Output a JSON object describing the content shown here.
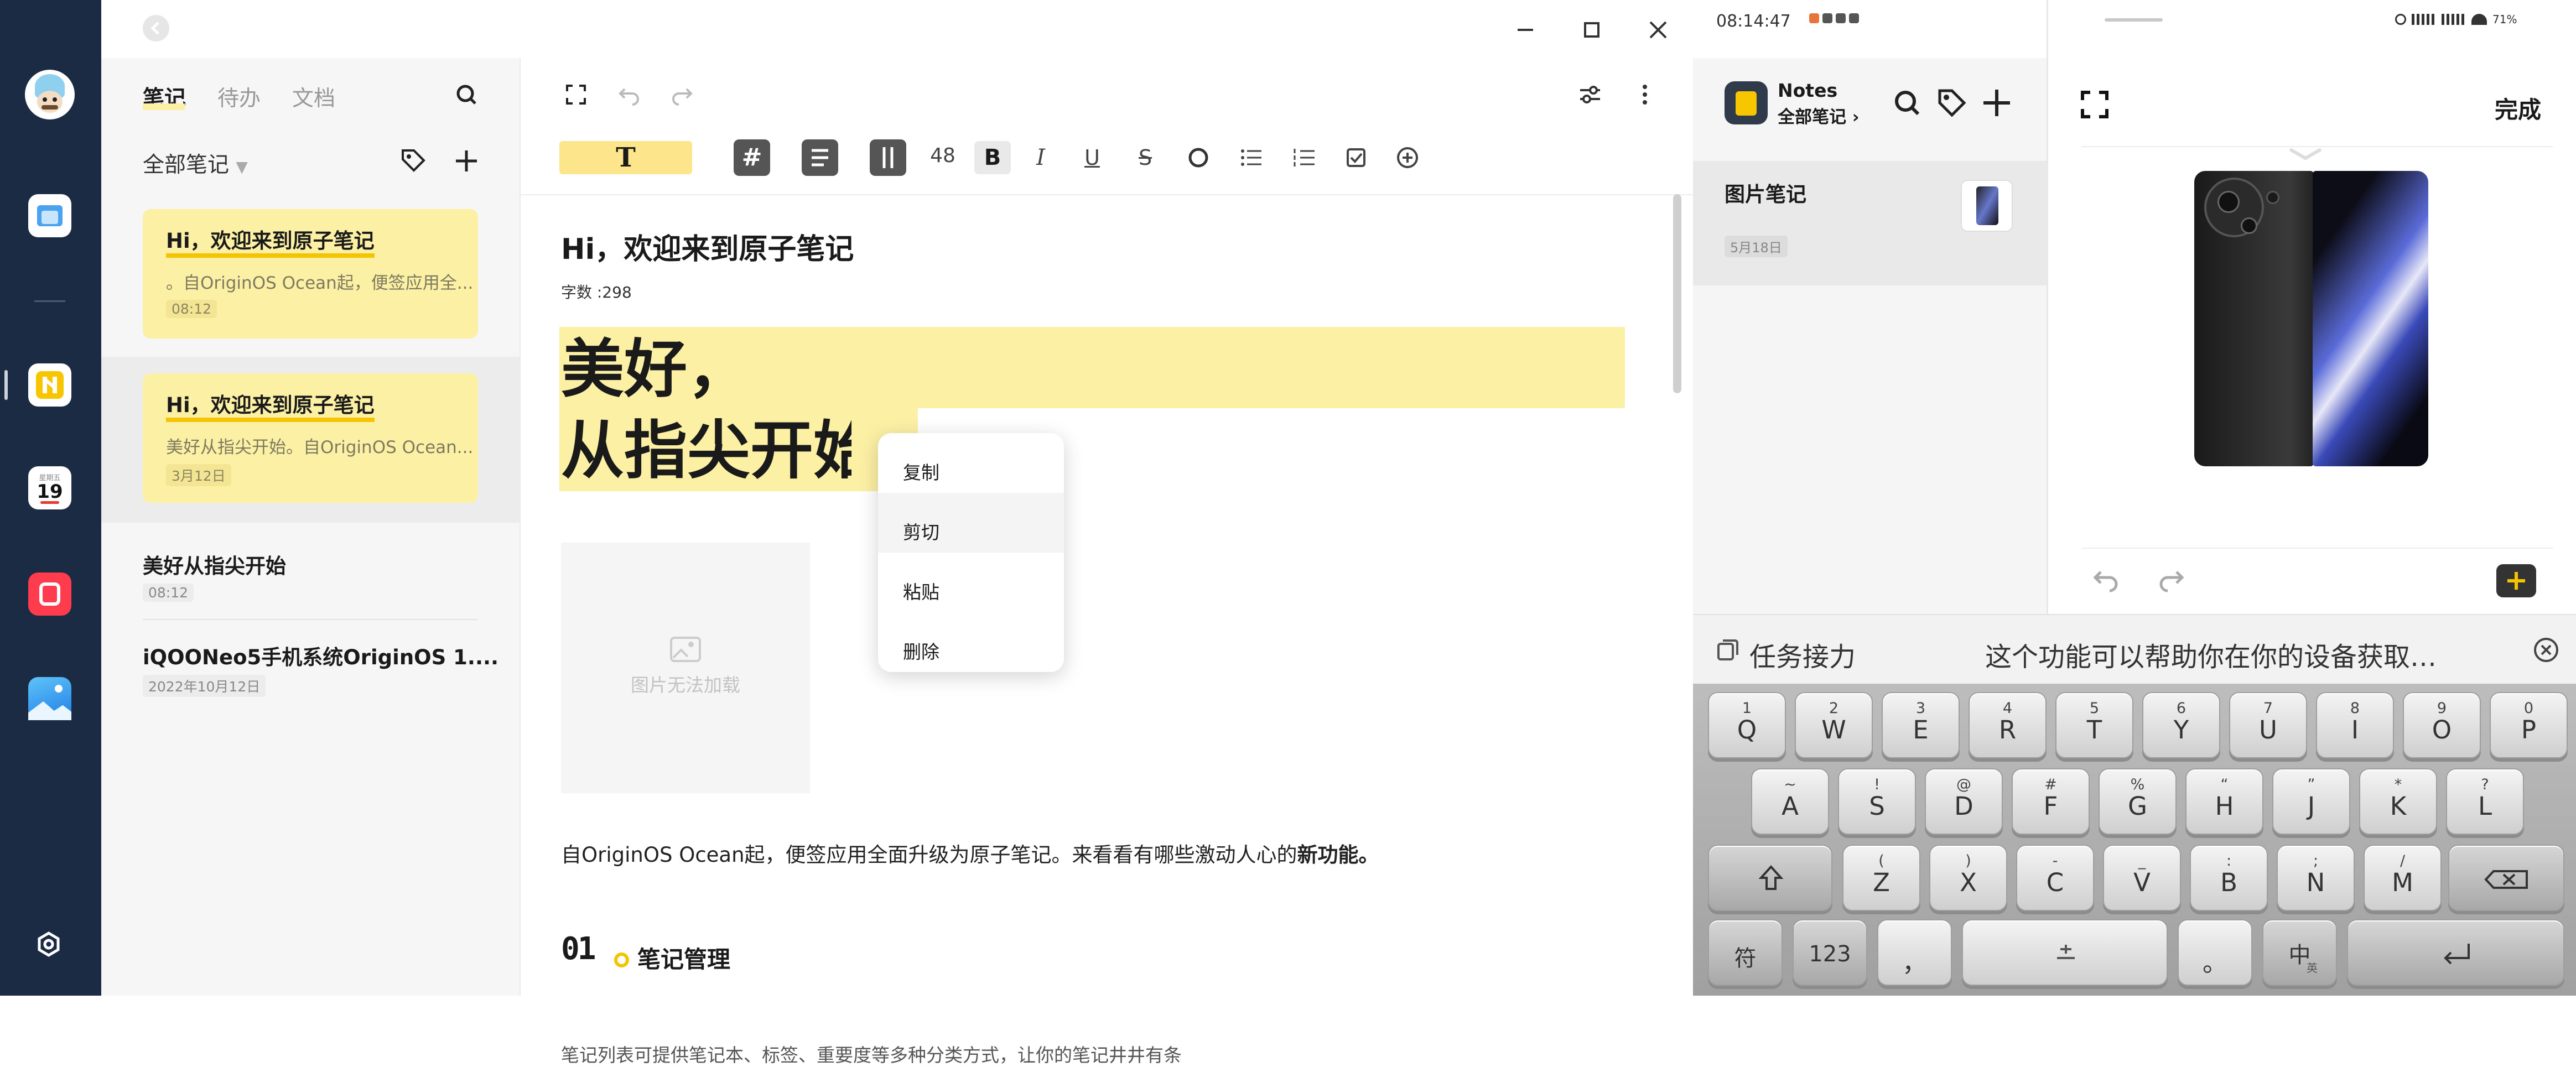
{
  "list": {
    "tabs": [
      "笔记",
      "待办",
      "文档"
    ],
    "filter": "全部笔记",
    "notes": [
      {
        "title": "Hi，欢迎来到原子笔记",
        "snippet": "。自OriginOS Ocean起，便签应用全...",
        "date": "08:12"
      },
      {
        "title": "Hi，欢迎来到原子笔记",
        "snippet": "美好从指尖开始。自OriginOS Ocean...",
        "date": "3月12日"
      },
      {
        "title": "美好从指尖开始",
        "snippet": "",
        "date": "08:12"
      },
      {
        "title": "iQOONeo5手机系统OriginOS 1....",
        "snippet": "",
        "date": "2022年10月12日"
      }
    ]
  },
  "editor": {
    "toolbar": {
      "font_size": "48",
      "title_style": "T"
    },
    "doc_title": "Hi，欢迎来到原子笔记",
    "word_count": "字数 :298",
    "headline1": "美好，",
    "headline2": "从指尖开始",
    "image_placeholder": "图片无法加载",
    "body": "自OriginOS Ocean起，便签应用全面升级为原子笔记。来看看有哪些激动人心的",
    "body_bold": "新功能。",
    "section_num": "01",
    "section_title": "笔记管理",
    "cut_line": "笔记列表可提供笔记本、标签、重要度等多种分类方式，让你的笔记井井有条"
  },
  "context_menu": [
    "复制",
    "剪切",
    "粘贴",
    "删除"
  ],
  "phone": {
    "status_time": "08:14:47",
    "status_right": "71%",
    "app_title": "Notes",
    "app_sub": "全部笔记",
    "note_title": "图片笔记",
    "note_date": "5月18日",
    "done": "完成",
    "relay_label": "任务接力",
    "relay_text": "这个功能可以帮助你在你的设备获取…"
  },
  "keyboard": {
    "row1": [
      [
        "1",
        "Q"
      ],
      [
        "2",
        "W"
      ],
      [
        "3",
        "E"
      ],
      [
        "4",
        "R"
      ],
      [
        "5",
        "T"
      ],
      [
        "6",
        "Y"
      ],
      [
        "7",
        "U"
      ],
      [
        "8",
        "I"
      ],
      [
        "9",
        "O"
      ],
      [
        "0",
        "P"
      ]
    ],
    "row2": [
      [
        "~",
        "A"
      ],
      [
        "!",
        "S"
      ],
      [
        "@",
        "D"
      ],
      [
        "#",
        "F"
      ],
      [
        "%",
        "G"
      ],
      [
        "“",
        "H"
      ],
      [
        "”",
        "J"
      ],
      [
        "*",
        "K"
      ],
      [
        "?",
        "L"
      ]
    ],
    "row3": [
      [
        "(",
        "Z"
      ],
      [
        ")",
        "X"
      ],
      [
        "-",
        "C"
      ],
      [
        "_",
        "V"
      ],
      [
        ":",
        "B"
      ],
      [
        ";",
        "N"
      ],
      [
        "/",
        "M"
      ]
    ],
    "fn": "符",
    "num": "123",
    "comma": "，",
    "period": "。",
    "lang": "中",
    "lang_sub": "英"
  },
  "colors": {
    "dock": "#1b2b44",
    "highlight": "#fcf0a5",
    "accent": "#f5c400"
  }
}
